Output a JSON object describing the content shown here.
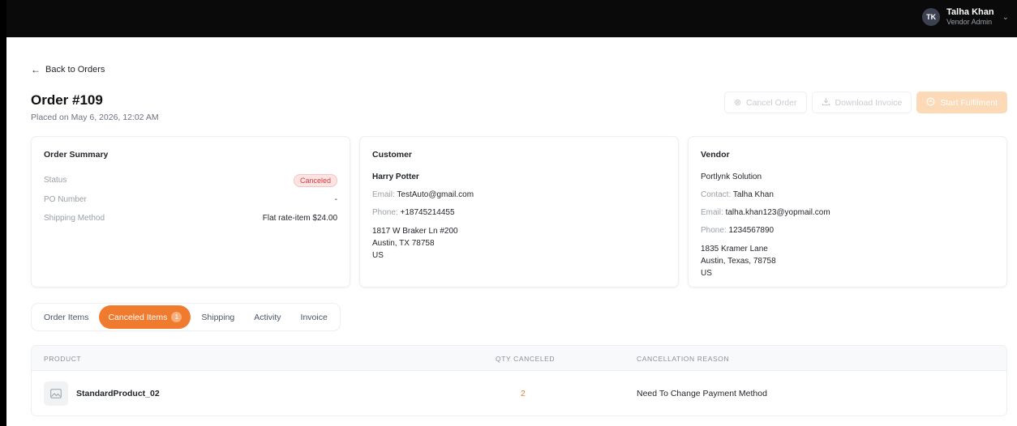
{
  "user": {
    "initials": "TK",
    "name": "Talha Khan",
    "role": "Vendor Admin"
  },
  "nav": {
    "back_label": "Back to Orders"
  },
  "order": {
    "title": "Order #109",
    "placed": "Placed on May 6, 2026, 12:02 AM"
  },
  "actions": {
    "cancel_label": "Cancel Order",
    "download_label": "Download Invoice",
    "fulfill_label": "Start Fulfilment"
  },
  "summary": {
    "title": "Order Summary",
    "status_label": "Status",
    "status_value": "Canceled",
    "po_label": "PO Number",
    "po_value": "-",
    "shipping_label": "Shipping Method",
    "shipping_value": "Flat rate-item $24.00"
  },
  "customer": {
    "title": "Customer",
    "name": "Harry Potter",
    "email_label": "Email:",
    "email": "TestAuto@gmail.com",
    "phone_label": "Phone:",
    "phone": "+18745214455",
    "address": [
      "1817 W Braker Ln #200",
      "Austin, TX 78758",
      "US"
    ]
  },
  "vendor": {
    "title": "Vendor",
    "company": "Portlynk Solution",
    "contact_label": "Contact:",
    "contact": "Talha Khan",
    "email_label": "Email:",
    "email": "talha.khan123@yopmail.com",
    "phone_label": "Phone:",
    "phone": "1234567890",
    "address": [
      "1835 Kramer Lane",
      "Austin, Texas, 78758",
      "US"
    ]
  },
  "tabs": {
    "order_items": "Order Items",
    "canceled_items": "Canceled Items",
    "canceled_count": "1",
    "shipping": "Shipping",
    "activity": "Activity",
    "invoice": "Invoice"
  },
  "table": {
    "headers": {
      "product": "PRODUCT",
      "qty": "QTY CANCELED",
      "reason": "CANCELLATION REASON"
    },
    "rows": [
      {
        "product": "StandardProduct_02",
        "qty": "2",
        "reason": "Need To Change Payment Method"
      }
    ]
  },
  "colors": {
    "accent": "#f07a2d",
    "accent_disabled": "#fcd9b7",
    "danger": "#d83a3a"
  }
}
